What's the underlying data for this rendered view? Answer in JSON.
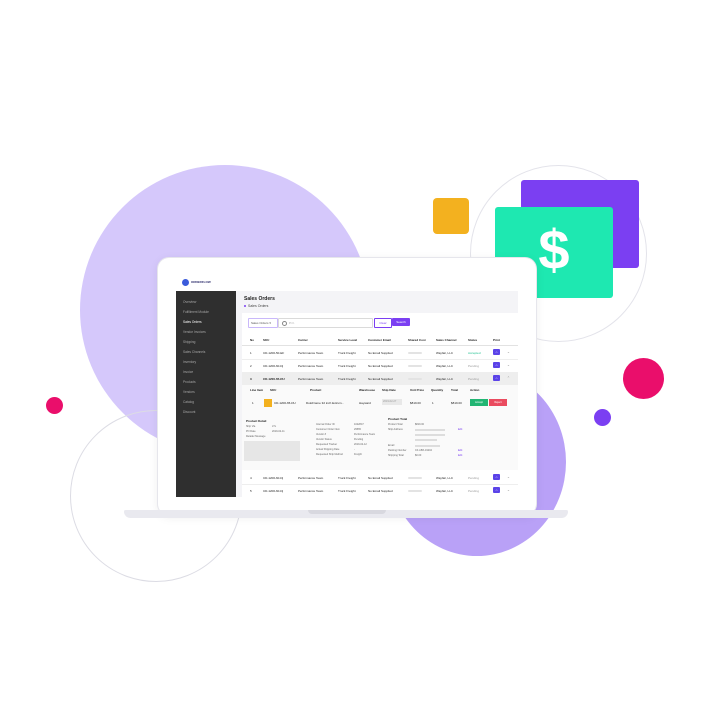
{
  "brand": {
    "logo_text": "ORDERFLOW",
    "dollar_symbol": "$"
  },
  "sidebar": {
    "items": [
      {
        "label": "Overview"
      },
      {
        "label": "Fulfillment Module"
      },
      {
        "label": "Sales Orders",
        "active": true
      },
      {
        "label": "Vendor Invoices"
      },
      {
        "label": "Shipping"
      },
      {
        "label": "Sales Channels"
      },
      {
        "label": "Inventory"
      },
      {
        "label": "Invoice"
      },
      {
        "label": "Products"
      },
      {
        "label": "Vendors"
      },
      {
        "label": "Catalog"
      },
      {
        "label": "Discount"
      }
    ]
  },
  "page": {
    "title": "Sales Orders",
    "breadcrumb": "Sales Orders"
  },
  "filters": {
    "select_label": "Sales Orders ▾",
    "search_placeholder": "P.O.",
    "clear_label": "Clear",
    "search_label": "Search"
  },
  "table": {
    "headers": [
      "No",
      "SKU",
      "Carrier",
      "Service Level",
      "Customer Email",
      "Shared Cost",
      "Sales Channel",
      "Status",
      "Print"
    ],
    "rows": [
      {
        "no": "1",
        "sku": "CD-1200-50-EF",
        "carrier": "Performance Team",
        "service": "Truck Freight",
        "email": "No Email Supplied",
        "channel": "Wayfair, LLC",
        "status": "Accepted"
      },
      {
        "no": "2",
        "sku": "CD-1200-60-Dj",
        "carrier": "Performance Team",
        "service": "Truck Freight",
        "email": "No Email Supplied",
        "channel": "Wayfair, LLC",
        "status": "Pending"
      },
      {
        "no": "3",
        "sku": "CD-1200-65-DU",
        "carrier": "Performance Team",
        "service": "Truck Freight",
        "email": "No Email Supplied",
        "channel": "Wayfair, LLC",
        "status": "Pending"
      },
      {
        "no": "4",
        "sku": "CD-1200-60-Dj",
        "carrier": "Performance Team",
        "service": "Truck Freight",
        "email": "No Email Supplied",
        "channel": "Wayfair, LLC",
        "status": "Pending"
      },
      {
        "no": "5",
        "sku": "CD-1200-60-Dj",
        "carrier": "Performance Team",
        "service": "Truck Freight",
        "email": "No Email Supplied",
        "channel": "Wayfair, LLC",
        "status": "Pending"
      }
    ]
  },
  "detail": {
    "headers": [
      "Line Item",
      "SKU",
      "Product",
      "Warehouse",
      "Ship Date",
      "Unit Price",
      "Quantity",
      "Total",
      "Action"
    ],
    "line": {
      "no": "1",
      "sku": "CD-1200-65-DU",
      "product": "DuloFrame 32 inch Extruin...",
      "warehouse": "Hayward",
      "ship_date": "2019-02-27",
      "unit_price": "$819.00",
      "quantity": "1",
      "total": "$819.00",
      "accept": "Accept",
      "reject": "Reject"
    },
    "product_detail": {
      "title": "Product Detail",
      "fields": [
        {
          "label": "Ship Via",
          "value": "LTL"
        },
        {
          "label": "PO Date",
          "value": "2019-02-11"
        },
        {
          "label": "Retailer Message",
          "value": ""
        }
      ]
    },
    "order_info": [
      {
        "label": "Internal Order ID",
        "value": "1022847"
      },
      {
        "label": "Customer Order Num",
        "value": "29565"
      },
      {
        "label": "Vendor #",
        "value": "Performance Team"
      },
      {
        "label": "Vendor Status",
        "value": "Pending"
      },
      {
        "label": "Requested Tracker",
        "value": "2019-02-12"
      },
      {
        "label": "Actual Shipping Date",
        "value": "-"
      },
      {
        "label": "Requested Ship Method",
        "value": "Freight"
      }
    ],
    "product_total": {
      "title": "Product Total",
      "fields": [
        {
          "label": "Product Total",
          "value": "$819.00"
        },
        {
          "label": "Ship Address",
          "value": ""
        },
        {
          "label": "Email",
          "value": ""
        },
        {
          "label": "Packing Number",
          "value": "CF-ABX-19204"
        },
        {
          "label": "Shipping Total",
          "value": "$0.00"
        }
      ],
      "edit_label": "Edit"
    }
  },
  "colors": {
    "accent": "#7b3ff2",
    "money": "#1ee8b1",
    "pink": "#ea0e6b",
    "yellow": "#f3b11f",
    "sidebar": "#2f2f2f"
  }
}
